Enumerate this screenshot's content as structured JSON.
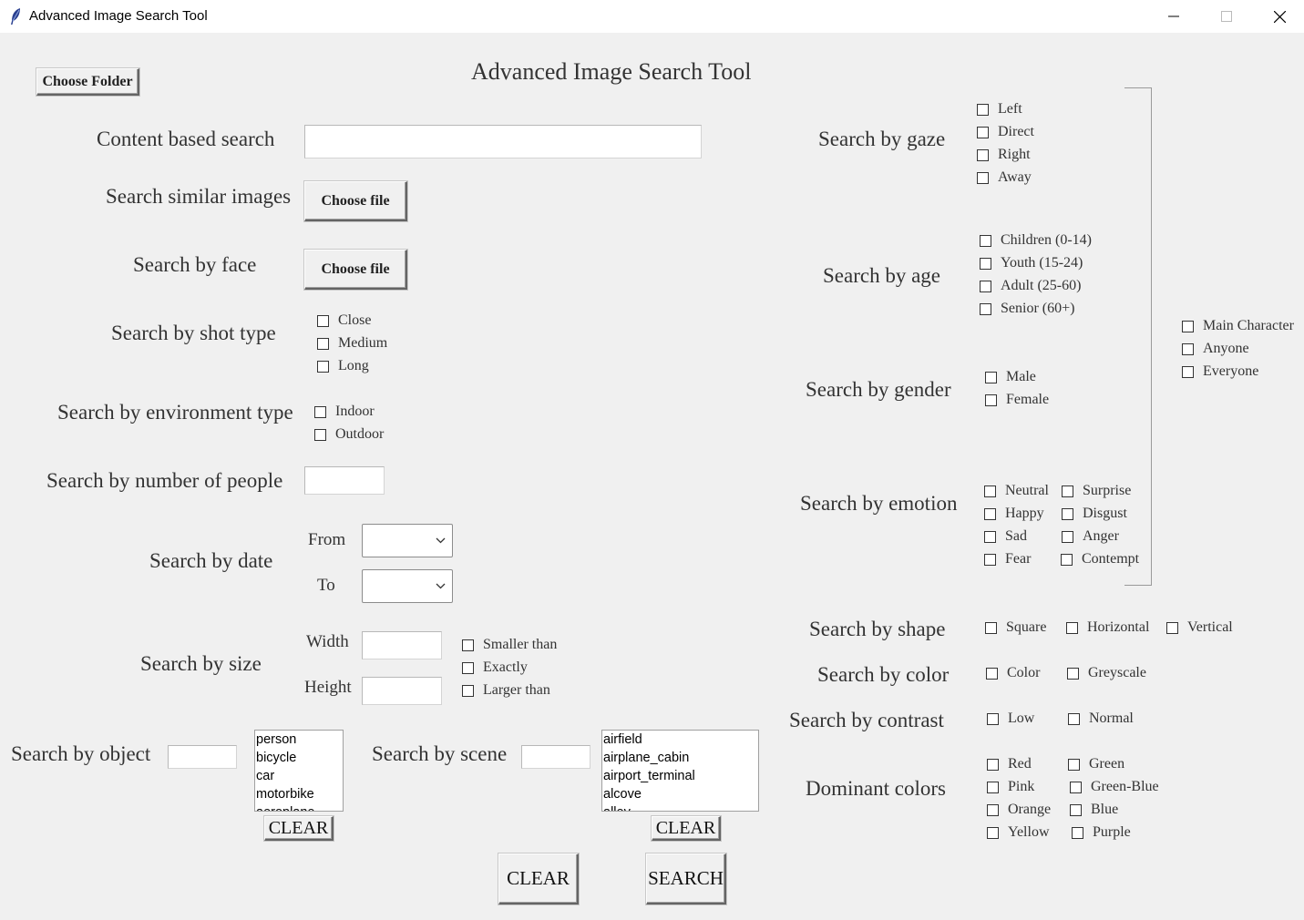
{
  "window": {
    "title": "Advanced Image Search Tool",
    "icons": {
      "app": "feather-icon",
      "minimize": "minimize-icon",
      "maximize": "maximize-icon",
      "close": "close-icon"
    }
  },
  "app_title": "Advanced Image Search Tool",
  "choose_folder": "Choose Folder",
  "left": {
    "content_search": {
      "label": "Content based search",
      "value": ""
    },
    "similar": {
      "label": "Search similar images",
      "button": "Choose file"
    },
    "face": {
      "label": "Search by face",
      "button": "Choose file"
    },
    "shot_type": {
      "label": "Search by shot type",
      "options": [
        "Close",
        "Medium",
        "Long"
      ]
    },
    "environment": {
      "label": "Search by environment type",
      "options": [
        "Indoor",
        "Outdoor"
      ]
    },
    "people": {
      "label": "Search by number of people",
      "value": ""
    },
    "date": {
      "label": "Search by date",
      "from": "From",
      "to": "To",
      "from_value": "",
      "to_value": ""
    },
    "size": {
      "label": "Search by size",
      "width": "Width",
      "height": "Height",
      "width_value": "",
      "height_value": "",
      "options": [
        "Smaller than",
        "Exactly",
        "Larger than"
      ]
    },
    "object": {
      "label": "Search by object",
      "value": "",
      "items": [
        "person",
        "bicycle",
        "car",
        "motorbike",
        "aeroplane"
      ],
      "clear": "CLEAR"
    },
    "scene": {
      "label": "Search by scene",
      "value": "",
      "items": [
        "airfield",
        "airplane_cabin",
        "airport_terminal",
        "alcove",
        "alley"
      ],
      "clear": "CLEAR"
    }
  },
  "right": {
    "gaze": {
      "label": "Search by gaze",
      "options": [
        "Left",
        "Direct",
        "Right",
        "Away"
      ]
    },
    "age": {
      "label": "Search by age",
      "options": [
        "Children (0-14)",
        "Youth (15-24)",
        "Adult (25-60)",
        "Senior (60+)"
      ]
    },
    "gender": {
      "label": "Search by gender",
      "options": [
        "Male",
        "Female"
      ]
    },
    "emotion": {
      "label": "Search by emotion",
      "col1": [
        "Neutral",
        "Happy",
        "Sad",
        "Fear"
      ],
      "col2": [
        "Surprise",
        "Disgust",
        "Anger",
        "Contempt"
      ]
    },
    "scope": {
      "options": [
        "Main Character",
        "Anyone",
        "Everyone"
      ]
    },
    "shape": {
      "label": "Search by shape",
      "options": [
        "Square",
        "Horizontal",
        "Vertical"
      ]
    },
    "color": {
      "label": "Search by color",
      "options": [
        "Color",
        "Greyscale"
      ]
    },
    "contrast": {
      "label": "Search by contrast",
      "options": [
        "Low",
        "Normal"
      ]
    },
    "dominant": {
      "label": "Dominant colors",
      "col1": [
        "Red",
        "Pink",
        "Orange",
        "Yellow"
      ],
      "col2": [
        "Green",
        "Green-Blue",
        "Blue",
        "Purple"
      ]
    }
  },
  "footer": {
    "clear": "CLEAR",
    "search": "SEARCH"
  }
}
